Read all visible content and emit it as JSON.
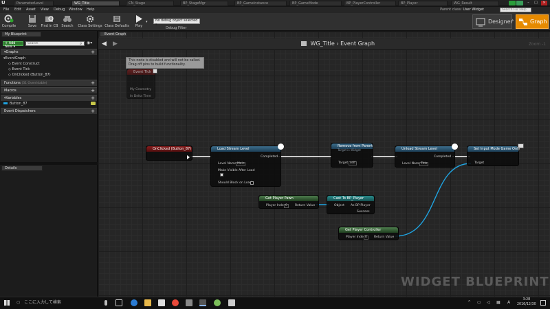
{
  "tabs": [
    {
      "label": "ParameterLevel",
      "active": false
    },
    {
      "label": "WG_Title",
      "active": true
    },
    {
      "label": "CN_Stage",
      "active": false
    },
    {
      "label": "BP_StageMgr",
      "active": false
    },
    {
      "label": "BP_GameInstance",
      "active": false
    },
    {
      "label": "BP_GameMode",
      "active": false
    },
    {
      "label": "BP_PlayerController",
      "active": false
    },
    {
      "label": "BP_Player",
      "active": false
    },
    {
      "label": "WG_Result",
      "active": false
    }
  ],
  "menubar": {
    "items": [
      "File",
      "Edit",
      "Asset",
      "View",
      "Debug",
      "Window",
      "Help"
    ],
    "parent_class_label": "Parent class:",
    "parent_class_value": "User Widget",
    "search_placeholder": "Search For Help"
  },
  "toolbar": {
    "compile": "Compile",
    "save": "Save",
    "find_in_cb": "Find in CB",
    "search": "Search",
    "class_settings": "Class Settings",
    "class_defaults": "Class Defaults",
    "play": "Play",
    "debug_select": "No debug object selected",
    "debug_filter": "Debug Filter",
    "designer": "Designer",
    "graph": "Graph"
  },
  "left_panel": {
    "tab": "My Blueprint",
    "add_new": "Add New",
    "search_placeholder": "Search",
    "graphs_header": "Graphs",
    "graph_items": [
      "EventGraph",
      "Event Construct",
      "Event Tick",
      "OnClicked (Button_87)"
    ],
    "functions_header": "Functions",
    "functions_note": "(31 Overridable)",
    "macros_header": "Macros",
    "variables_header": "Variables",
    "variable_items": [
      "Button_87"
    ],
    "dispatchers_header": "Event Dispatchers",
    "details_tab": "Details"
  },
  "graph": {
    "tab": "Event Graph",
    "breadcrumb_root": "WG_Title",
    "breadcrumb_leaf": "Event Graph",
    "zoom": "Zoom -1",
    "watermark": "WIDGET BLUEPRINT",
    "tooltip": "This node is disabled and will not be called. Drag off pins to build functionality.",
    "disabled_node": {
      "title": "Event Tick",
      "pins": [
        "My Geometry",
        "In Delta Time"
      ]
    },
    "nodes": {
      "onclicked": {
        "title": "OnClicked (Button_87)"
      },
      "load_stream": {
        "title": "Load Stream Level",
        "level_label": "Level Name",
        "level_value": "Main",
        "visible_label": "Make Visible After Load",
        "block_label": "Should Block on Load",
        "completed": "Completed"
      },
      "remove_parent": {
        "title": "Remove from Parent",
        "subtitle": "Target is Widget",
        "target_label": "Target",
        "target_value": "self"
      },
      "unload_stream": {
        "title": "Unload Stream Level",
        "level_label": "Level Name",
        "level_value": "Title",
        "completed": "Completed"
      },
      "set_input": {
        "title": "Set Input Mode Game Only",
        "target_label": "Target"
      },
      "get_pawn": {
        "title": "Get Player Pawn",
        "index_label": "Player Index",
        "index_value": "0",
        "return_label": "Return Value"
      },
      "cast": {
        "title": "Cast To BP_Player",
        "object_label": "Object",
        "as_label": "As BP Player",
        "success_label": "Success"
      },
      "get_controller": {
        "title": "Get Player Controller",
        "index_label": "Player Index",
        "index_value": "0",
        "return_label": "Return Value"
      }
    }
  },
  "taskbar": {
    "search_text": "ここに入力して検索",
    "time": "3:28",
    "date": "2016/12/30"
  },
  "colors": {
    "accent": "#e68a00",
    "exec_wire": "#ffffff",
    "object_wire": "#1fa3e0",
    "node_red": "#8a1c1c",
    "node_blue": "#3d6f8e",
    "node_green": "#4f7f4f",
    "node_teal": "#2a8f8f"
  }
}
